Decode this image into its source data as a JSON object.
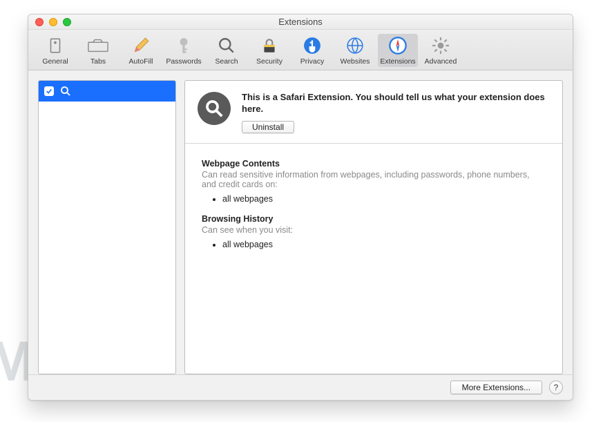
{
  "window": {
    "title": "Extensions"
  },
  "toolbar": {
    "items": [
      {
        "label": "General"
      },
      {
        "label": "Tabs"
      },
      {
        "label": "AutoFill"
      },
      {
        "label": "Passwords"
      },
      {
        "label": "Search"
      },
      {
        "label": "Security"
      },
      {
        "label": "Privacy"
      },
      {
        "label": "Websites"
      },
      {
        "label": "Extensions"
      },
      {
        "label": "Advanced"
      }
    ]
  },
  "detail": {
    "description": "This is a Safari Extension. You should tell us what your extension does here.",
    "uninstall_label": "Uninstall",
    "sections": {
      "contents": {
        "heading": "Webpage Contents",
        "sub": "Can read sensitive information from webpages, including passwords, phone numbers, and credit cards on:",
        "bullet": "all webpages"
      },
      "history": {
        "heading": "Browsing History",
        "sub": "Can see when you visit:",
        "bullet": "all webpages"
      }
    }
  },
  "footer": {
    "more_label": "More Extensions...",
    "help_label": "?"
  },
  "watermark": "MALWARETIPS"
}
